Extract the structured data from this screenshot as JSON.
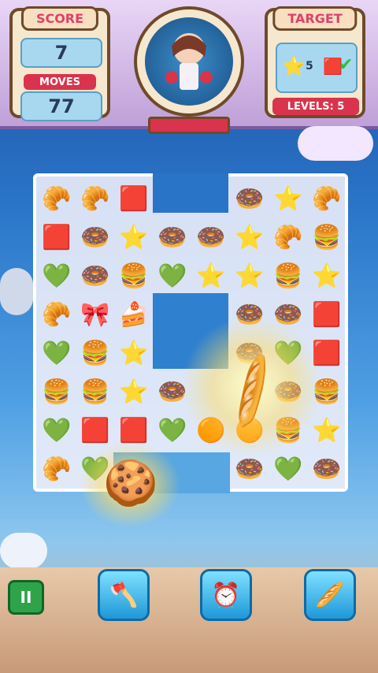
{
  "score_panel": {
    "title": "SCORE",
    "score_value": "7",
    "moves_label": "MOVES",
    "moves_value": "77"
  },
  "target_panel": {
    "title": "TARGET",
    "star_count": "5",
    "levels_label": "LEVELS: 5"
  },
  "board": {
    "rows": [
      [
        "🥐",
        "🥐",
        "🟥",
        "",
        "",
        "🍩",
        "⭐",
        "🥐"
      ],
      [
        "🟥",
        "🍩",
        "⭐",
        "🍩",
        "🍩",
        "⭐",
        "🥐",
        "🍔"
      ],
      [
        "💚",
        "🍩",
        "🍔",
        "💚",
        "⭐",
        "⭐",
        "🍔",
        "⭐"
      ],
      [
        "🥐",
        "🎀",
        "🍰",
        "",
        "",
        "🍩",
        "🍩",
        "🟥"
      ],
      [
        "💚",
        "🍔",
        "⭐",
        "",
        "",
        "🍩",
        "💚",
        "🟥"
      ],
      [
        "🍔",
        "🍔",
        "⭐",
        "🍩",
        "",
        "",
        "🍩",
        "🍔"
      ],
      [
        "💚",
        "🟥",
        "🟥",
        "💚",
        "🟠",
        "🟠",
        "🍔",
        "⭐"
      ],
      [
        "🥐",
        "💚",
        "",
        "",
        "",
        "🍩",
        "💚",
        "🍩"
      ]
    ]
  },
  "toolbar": {
    "pause_label": "II",
    "tool_shovel": "🪓",
    "tool_clock": "⏰",
    "tool_hammer": "🥖"
  },
  "effects": {
    "cookie_icon": "🍪",
    "hammer_icon": "🥖"
  }
}
